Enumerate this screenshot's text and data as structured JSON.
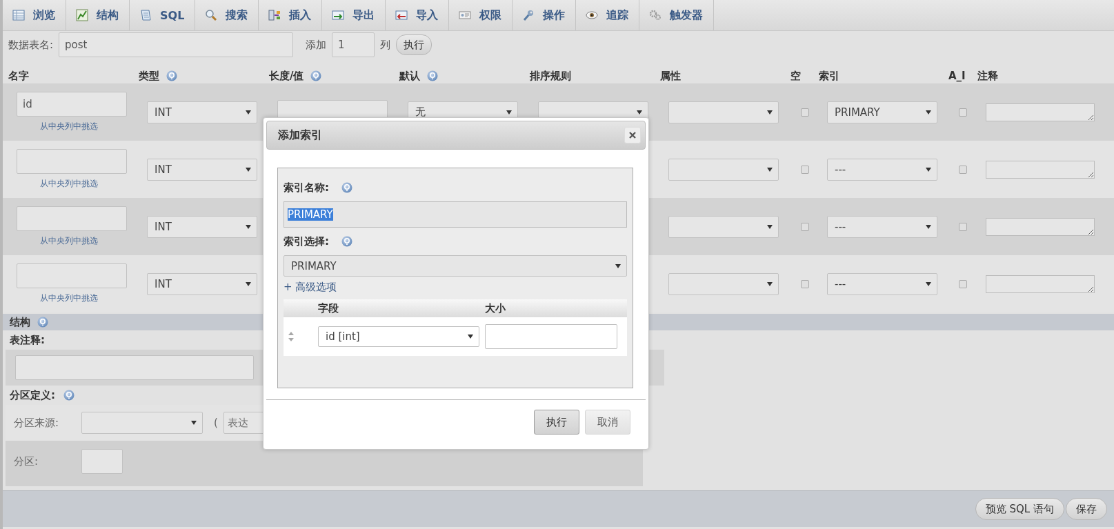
{
  "tabs": [
    {
      "label": "浏览"
    },
    {
      "label": "结构"
    },
    {
      "label": "SQL"
    },
    {
      "label": "搜索"
    },
    {
      "label": "插入"
    },
    {
      "label": "导出"
    },
    {
      "label": "导入"
    },
    {
      "label": "权限"
    },
    {
      "label": "操作"
    },
    {
      "label": "追踪"
    },
    {
      "label": "触发器"
    }
  ],
  "table_name": {
    "label": "数据表名:",
    "value": "post"
  },
  "add_columns": {
    "label": "添加",
    "value": "1",
    "unit": "列",
    "button": "执行"
  },
  "columns": [
    {
      "label": "名字"
    },
    {
      "label": "类型",
      "help": true
    },
    {
      "label": "长度/值",
      "help": true
    },
    {
      "label": "默认",
      "help": true
    },
    {
      "label": "排序规则"
    },
    {
      "label": "属性"
    },
    {
      "label": "空"
    },
    {
      "label": "索引"
    },
    {
      "label": "A_I"
    },
    {
      "label": "注释"
    }
  ],
  "rows": [
    {
      "name": "id",
      "link": "从中央列中挑选",
      "type": "INT",
      "default": "无",
      "null": false,
      "index": "PRIMARY",
      "ai": false
    },
    {
      "link": "从中央列中挑选",
      "type": "INT",
      "null": false,
      "index": "---",
      "ai": false
    },
    {
      "link": "从中央列中挑选",
      "type": "INT",
      "null": false,
      "index": "---",
      "ai": false
    },
    {
      "link": "从中央列中挑选",
      "type": "INT",
      "null": false,
      "index": "---",
      "ai": false
    }
  ],
  "structure": {
    "title": "结构"
  },
  "table_comment": {
    "label": "表注释:"
  },
  "partition": {
    "title": "分区定义:",
    "source_label": "分区来源:",
    "paren": "(",
    "expression_placeholder": "表达",
    "count_label": "分区:"
  },
  "footer_buttons": [
    "预览 SQL 语句",
    "保存"
  ],
  "dialog": {
    "title": "添加索引",
    "name_label": "索引名称:",
    "name_value": "PRIMARY",
    "name_value_highlighted": true,
    "choice_label": "索引选择:",
    "choice_value": "PRIMARY",
    "advanced": "+ 高级选项",
    "table_columns": [
      "字段",
      "大小"
    ],
    "field_rows": [
      {
        "field": "id [int]"
      }
    ],
    "buttons": [
      {
        "label": "执行",
        "kind": "primary"
      },
      {
        "label": "取消",
        "kind": "secondary"
      }
    ]
  }
}
